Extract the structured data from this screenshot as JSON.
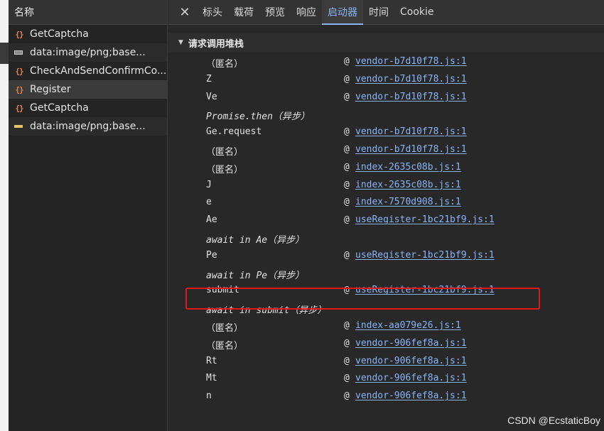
{
  "requests": {
    "header": "名称",
    "items": [
      {
        "icon": "json-icon",
        "name": "GetCaptcha"
      },
      {
        "icon": "image-icon",
        "name": "data:image/png;base..."
      },
      {
        "icon": "json-icon",
        "name": "CheckAndSendConfirmCo..."
      },
      {
        "icon": "json-icon",
        "name": "Register",
        "selected": true
      },
      {
        "icon": "json-icon",
        "name": "GetCaptcha"
      },
      {
        "icon": "image-icon",
        "name": "data:image/png;base..."
      }
    ]
  },
  "tabs": {
    "close": "✕",
    "items": [
      "标头",
      "载荷",
      "预览",
      "响应",
      "启动器",
      "时间",
      "Cookie"
    ],
    "active": "启动器"
  },
  "section": {
    "title": "请求调用堆栈"
  },
  "stack": [
    {
      "fn": "（匿名）",
      "at": "@",
      "loc": "vendor-b7d10f78.js:1"
    },
    {
      "fn": "Z",
      "at": "@",
      "loc": "vendor-b7d10f78.js:1"
    },
    {
      "fn": "Ve",
      "at": "@",
      "loc": "vendor-b7d10f78.js:1"
    },
    {
      "fn": "Promise.then（异步）",
      "async": true
    },
    {
      "fn": "Ge.request",
      "at": "@",
      "loc": "vendor-b7d10f78.js:1"
    },
    {
      "fn": "（匿名）",
      "at": "@",
      "loc": "vendor-b7d10f78.js:1"
    },
    {
      "fn": "（匿名）",
      "at": "@",
      "loc": "index-2635c08b.js:1"
    },
    {
      "fn": "J",
      "at": "@",
      "loc": "index-2635c08b.js:1"
    },
    {
      "fn": "e",
      "at": "@",
      "loc": "index-7570d908.js:1"
    },
    {
      "fn": "Ae",
      "at": "@",
      "loc": "useRegister-1bc21bf9.js:1"
    },
    {
      "fn": "await in Ae（异步）",
      "async": true
    },
    {
      "fn": "Pe",
      "at": "@",
      "loc": "useRegister-1bc21bf9.js:1"
    },
    {
      "fn": "await in Pe（异步）",
      "async": true
    },
    {
      "fn": "submit",
      "at": "@",
      "loc": "useRegister-1bc21bf9.js:1"
    },
    {
      "fn": "await in submit（异步）",
      "async": true
    },
    {
      "fn": "（匿名）",
      "at": "@",
      "loc": "index-aa079e26.js:1"
    },
    {
      "fn": "（匿名）",
      "at": "@",
      "loc": "vendor-906fef8a.js:1"
    },
    {
      "fn": "Rt",
      "at": "@",
      "loc": "vendor-906fef8a.js:1"
    },
    {
      "fn": "Mt",
      "at": "@",
      "loc": "vendor-906fef8a.js:1"
    },
    {
      "fn": "n",
      "at": "@",
      "loc": "vendor-906fef8a.js:1"
    }
  ],
  "highlight_color": "#e01818",
  "watermark": "CSDN @EcstaticBoy"
}
